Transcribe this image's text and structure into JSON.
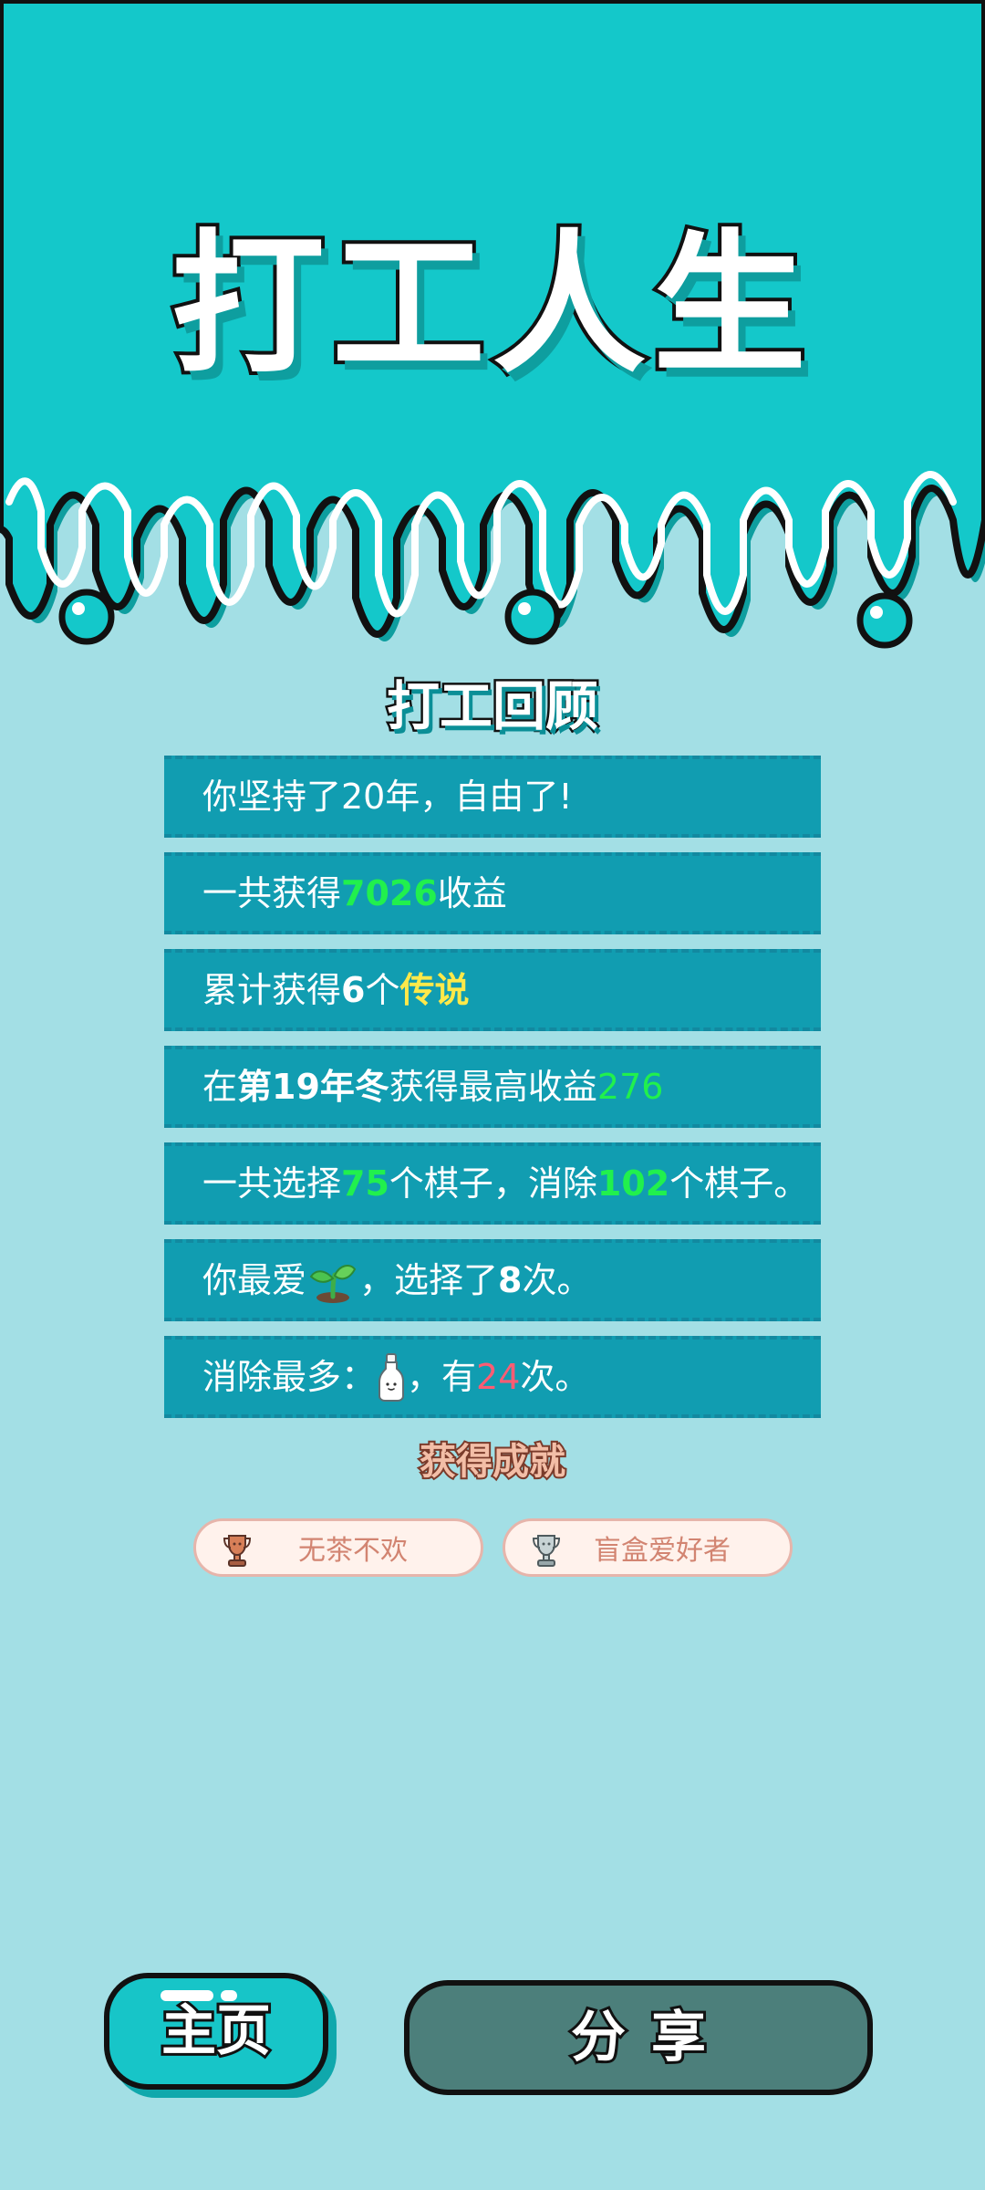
{
  "header": {
    "title": "打工人生"
  },
  "review": {
    "title": "打工回顾",
    "line1": {
      "text": "你坚持了20年，自由了!"
    },
    "line2": {
      "before": "一共获得",
      "value": "7026",
      "after": "收益"
    },
    "line3": {
      "before": "累计获得",
      "count": "6",
      "middle": "个",
      "rarity": "传说"
    },
    "line4": {
      "before": "在 ",
      "period": "第19年冬",
      "middle": " 获得最高收益",
      "value": "276"
    },
    "line5": {
      "before": "一共选择",
      "selected": "75",
      "middle": "个棋子，消除",
      "removed": "102",
      "after": "个棋子。"
    },
    "line6": {
      "before": "你最爱",
      "icon": "sprout-icon",
      "middle": "，选择了",
      "count": "8",
      "after": "次。"
    },
    "line7": {
      "before": "消除最多：",
      "icon": "milk-bottle-icon",
      "middle": "，有",
      "count": "24",
      "after": "次。"
    }
  },
  "achievements": {
    "title": "获得成就",
    "items": [
      {
        "label": "无茶不欢",
        "icon": "bronze-trophy-icon"
      },
      {
        "label": "盲盒爱好者",
        "icon": "silver-trophy-icon"
      }
    ]
  },
  "buttons": {
    "home": "主页",
    "share": "分享"
  },
  "colors": {
    "top_band": "#14c8ca",
    "background": "#a3dfe5",
    "card": "#119db1",
    "green_value": "#21f04d",
    "yellow_value": "#ffe949",
    "red_value": "#ff5c73",
    "share_button": "#4c7f7b"
  }
}
